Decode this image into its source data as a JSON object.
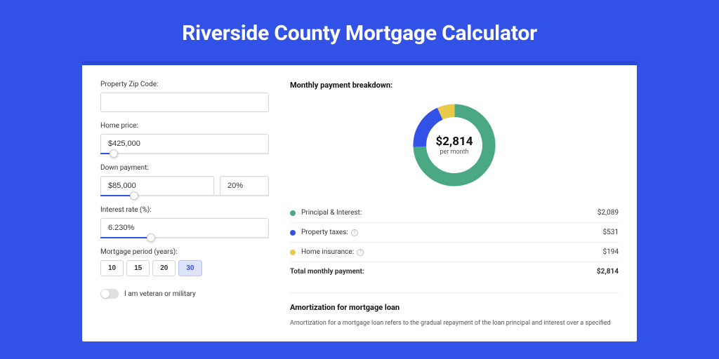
{
  "title": "Riverside County Mortgage Calculator",
  "form": {
    "zip_label": "Property Zip Code:",
    "zip_value": "",
    "home_price_label": "Home price:",
    "home_price_value": "$425,000",
    "home_price_slider_pct": 8,
    "down_label": "Down payment:",
    "down_value": "$85,000",
    "down_pct": "20%",
    "down_slider_pct": 20,
    "rate_label": "Interest rate (%):",
    "rate_value": "6.230%",
    "rate_slider_pct": 30,
    "period_label": "Mortgage period (years):",
    "periods": [
      "10",
      "15",
      "20",
      "30"
    ],
    "period_active": "30",
    "veteran_label": "I am veteran or military"
  },
  "breakdown": {
    "title": "Monthly payment breakdown:",
    "donut_amount": "$2,814",
    "donut_sub": "per month",
    "items": [
      {
        "color": "green",
        "label": "Principal & Interest:",
        "value": "$2,089",
        "info": false
      },
      {
        "color": "blue",
        "label": "Property taxes:",
        "value": "$531",
        "info": true
      },
      {
        "color": "yellow",
        "label": "Home insurance:",
        "value": "$194",
        "info": true
      }
    ],
    "total_label": "Total monthly payment:",
    "total_value": "$2,814"
  },
  "chart_data": {
    "type": "pie",
    "title": "Monthly payment breakdown",
    "series": [
      {
        "name": "Principal & Interest",
        "value": 2089,
        "color": "#4aa885"
      },
      {
        "name": "Property taxes",
        "value": 531,
        "color": "#3151e7"
      },
      {
        "name": "Home insurance",
        "value": 194,
        "color": "#e9c94b"
      }
    ],
    "total": 2814
  },
  "amort": {
    "title": "Amortization for mortgage loan",
    "text": "Amortization for a mortgage loan refers to the gradual repayment of the loan principal and interest over a specified"
  }
}
